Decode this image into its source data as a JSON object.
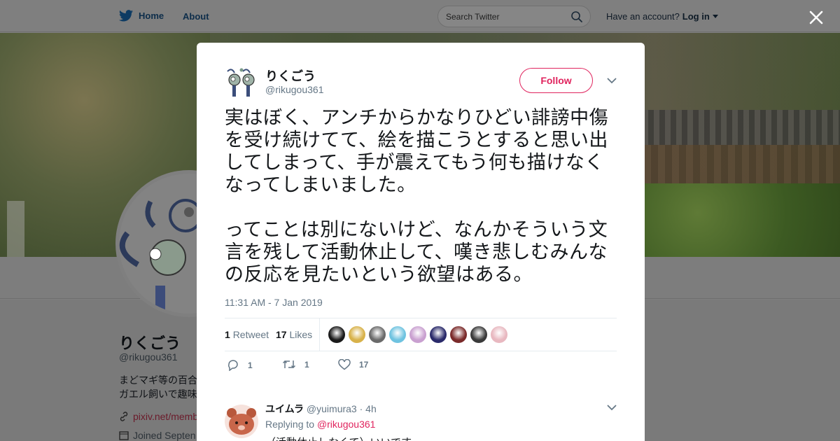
{
  "topbar": {
    "home_label": "Home",
    "about_label": "About",
    "search_placeholder": "Search Twitter",
    "account_prompt": "Have an account?",
    "login_label": "Log in"
  },
  "profile": {
    "name": "りくごう",
    "handle": "@rikugou361",
    "bio_line1": "まどマギ等の百合",
    "bio_line2": "ガエル飼いで趣味",
    "link": "pixiv.net/memb",
    "joined": "Joined Septen"
  },
  "tweet": {
    "author_name": "りくごう",
    "author_handle": "@rikugou361",
    "follow_label": "Follow",
    "text_p1": "実はぼく、アンチからかなりひどい誹謗中傷を受け続けてて、絵を描こうとすると思い出してしまって、手が震えてもう何も描けなくなってしまいました。",
    "text_p2": "ってことは別にないけど、なんかそういう文言を残して活動休止して、嘆き悲しむみんなの反応を見たいという欲望はある。",
    "timestamp": "11:31 AM - 7 Jan 2019",
    "retweet_count": "1",
    "retweet_label": "Retweet",
    "like_count": "17",
    "like_label": "Likes",
    "reply_action_count": "1",
    "retweet_action_count": "1",
    "like_action_count": "17"
  },
  "likers": [
    "#1a1a1a",
    "#d8b24a",
    "#6a6a6a",
    "#6fc3e0",
    "#c9a0d0",
    "#2a2a6a",
    "#7a2a2a",
    "#3a3a3a",
    "#e8b8c0"
  ],
  "reply": {
    "name": "ユイムラ",
    "handle": "@yuimura3",
    "time": "4h",
    "replying_prefix": "Replying to",
    "replying_to": "@rikugou361",
    "text": "（活動休止しなくて）いいです"
  },
  "colors": {
    "accent": "#e0245e",
    "muted": "#657786",
    "twitter_blue": "#1da1f2"
  }
}
